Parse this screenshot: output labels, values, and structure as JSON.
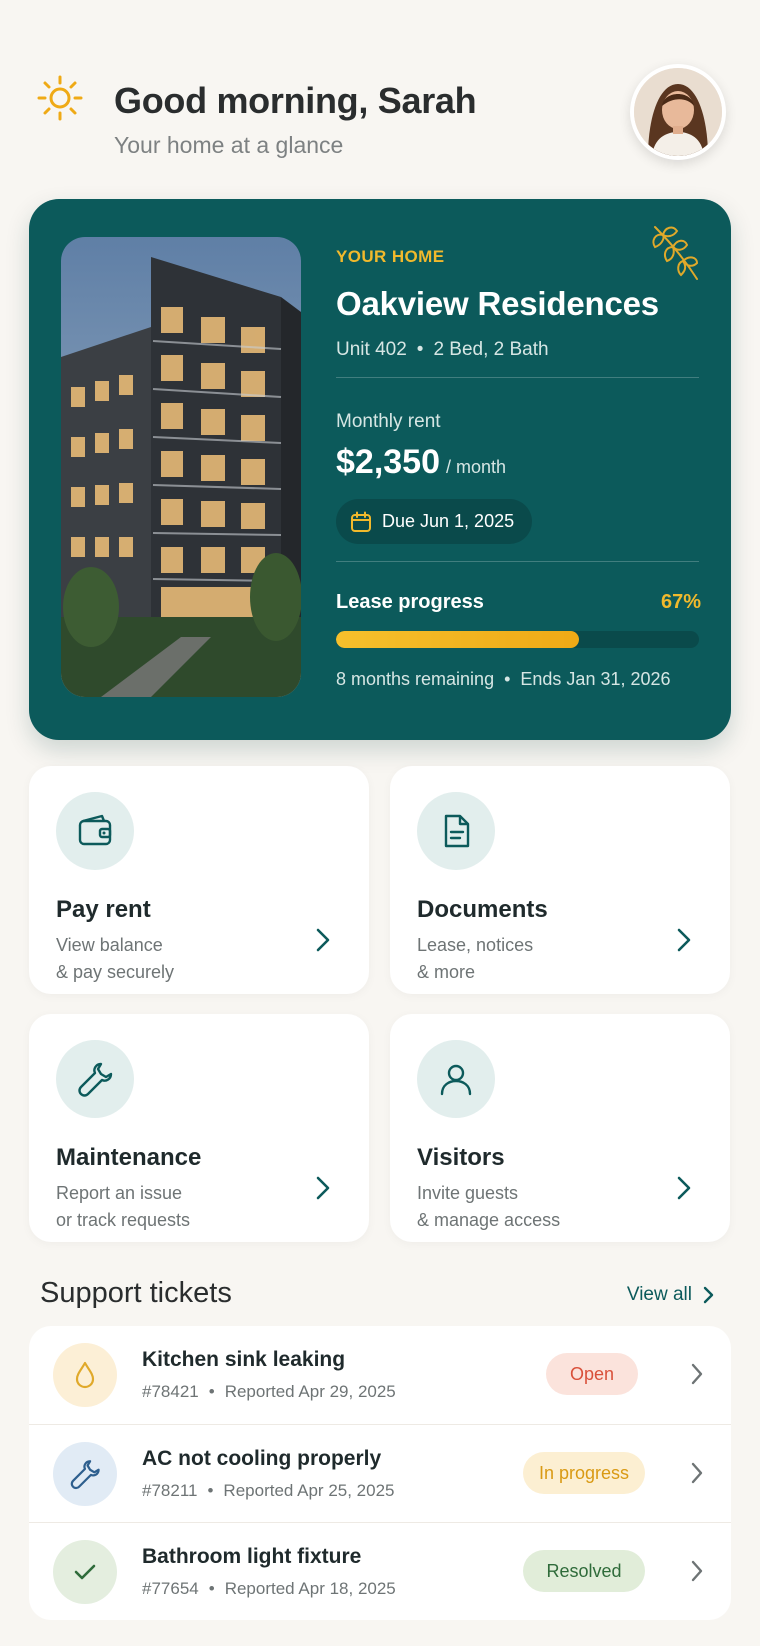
{
  "header": {
    "greeting": "Good morning, Sarah",
    "subtitle": "Your home at a glance"
  },
  "home": {
    "label": "YOUR HOME",
    "name": "Oakview Residences",
    "unit": "Unit 402",
    "layout": "2 Bed, 2 Bath",
    "rent_label": "Monthly rent",
    "rent_amount": "$2,350",
    "rent_period": "/ month",
    "due": "Due Jun 1, 2025",
    "lease_label": "Lease progress",
    "lease_percent_text": "67%",
    "lease_progress": 0.67,
    "remaining": "8 months remaining",
    "ends": "Ends Jan 31, 2026"
  },
  "tiles": [
    {
      "title": "Pay rent",
      "line1": "View balance",
      "line2": "& pay securely",
      "icon": "wallet-icon"
    },
    {
      "title": "Documents",
      "line1": "Lease, notices",
      "line2": "& more",
      "icon": "document-icon"
    },
    {
      "title": "Maintenance",
      "line1": "Report an issue",
      "line2": "or track requests",
      "icon": "wrench-icon"
    },
    {
      "title": "Visitors",
      "line1": "Invite guests",
      "line2": "& manage access",
      "icon": "person-icon"
    }
  ],
  "support": {
    "title": "Support tickets",
    "view_all": "View all",
    "tickets": [
      {
        "title": "Kitchen sink leaking",
        "id": "#78421",
        "reported": "Reported Apr 29, 2025",
        "status": "Open",
        "icon": "water-drop-icon"
      },
      {
        "title": "AC not cooling properly",
        "id": "#78211",
        "reported": "Reported Apr 25, 2025",
        "status": "In progress",
        "icon": "wrench-icon"
      },
      {
        "title": "Bathroom light fixture",
        "id": "#77654",
        "reported": "Reported Apr 18, 2025",
        "status": "Resolved",
        "icon": "checkmark-icon"
      }
    ]
  },
  "colors": {
    "brand_teal": "#0c5a5b",
    "accent_gold": "#f1b92c",
    "status_open": "#d9503a",
    "status_in_progress": "#d99a14",
    "status_resolved": "#2f6b3a"
  }
}
